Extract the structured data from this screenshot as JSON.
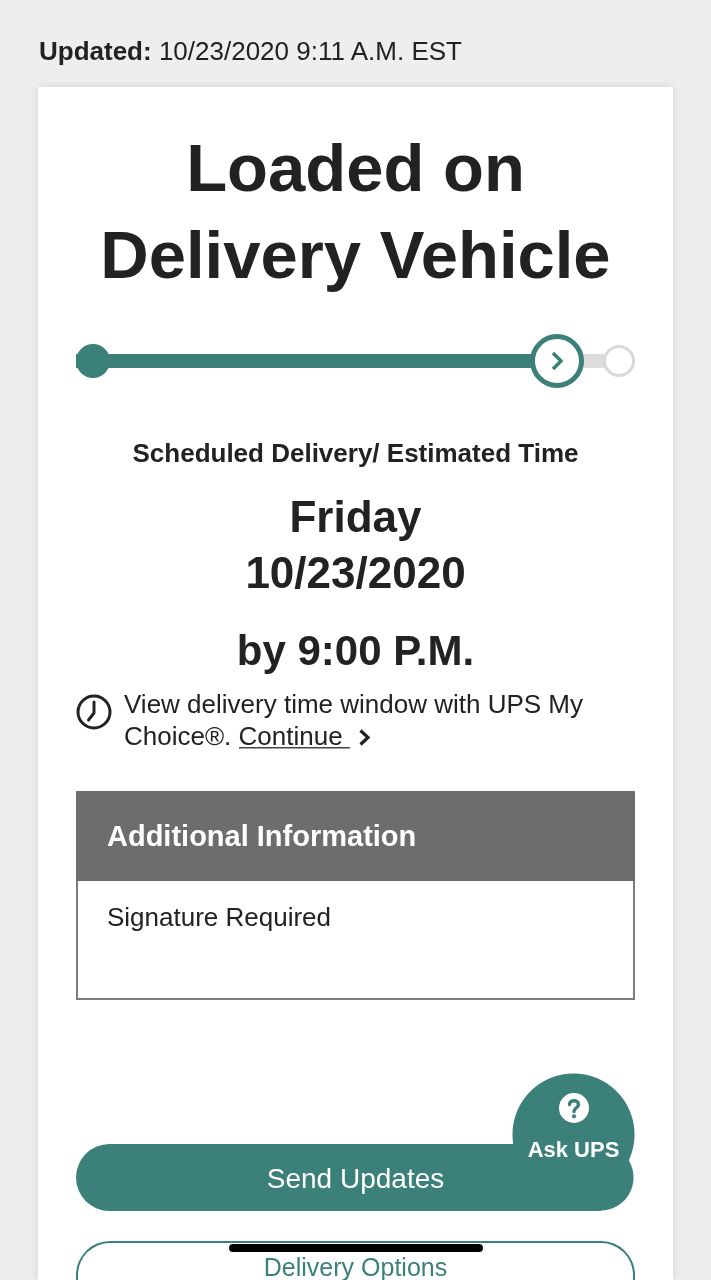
{
  "updated": {
    "text": "**Updated:** 10/23/2020 9:11 A.M. EST"
  },
  "status": {
    "title": "Loaded on Delivery Vehicle",
    "progress": {
      "level": 0.86
    }
  },
  "schedule": {
    "label": "Scheduled Delivery/ Estimated Time",
    "day": "Friday",
    "date": "10/23/2020",
    "time": "by 9:00 P.M."
  },
  "notice": {
    "text": "View delivery time window with UPS My Choice®.",
    "link": "Continue"
  },
  "additional_info": {
    "title": "Additional Information",
    "items": [
      "Signature Required"
    ]
  },
  "buttons": [
    {
      "label": "Send Updates",
      "kind": "primary"
    },
    {
      "label": "Delivery Options",
      "kind": "secondary"
    }
  ],
  "chat": {
    "label": "Ask UPS"
  }
}
